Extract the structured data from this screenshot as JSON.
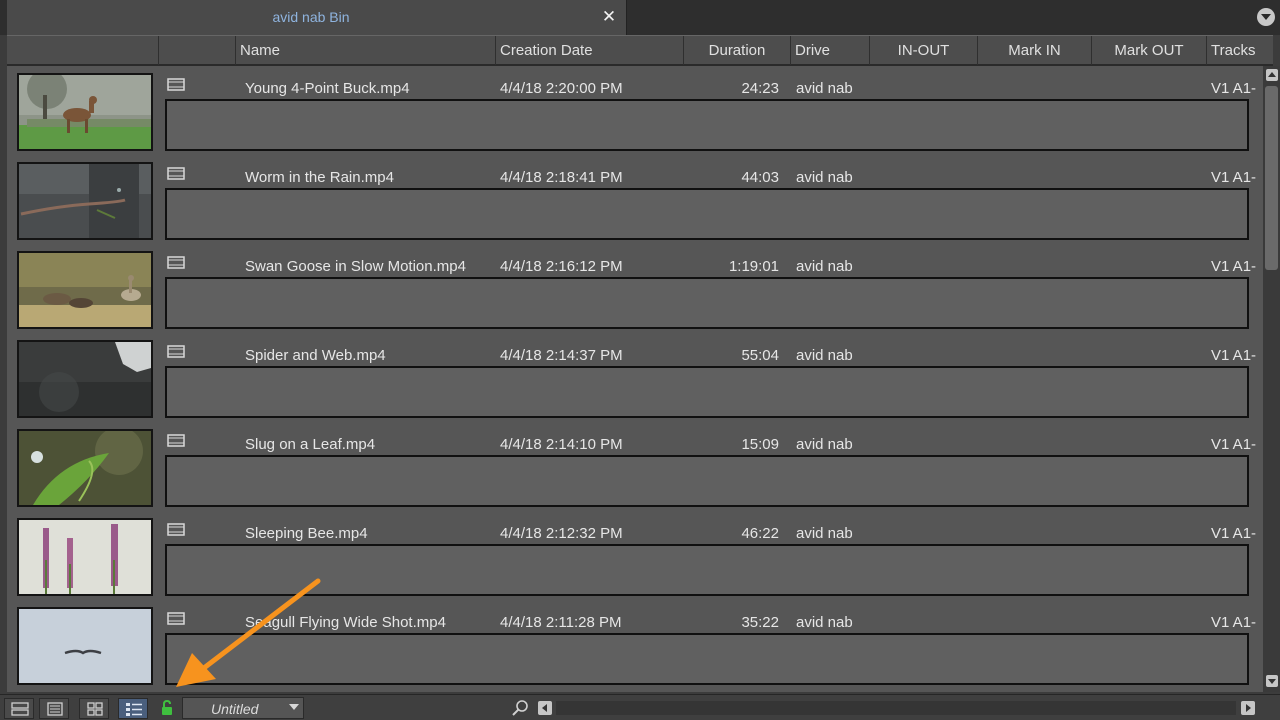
{
  "window": {
    "tab_title": "avid nab Bin",
    "close_glyph": "✕"
  },
  "columns": {
    "name": "Name",
    "creation_date": "Creation Date",
    "duration": "Duration",
    "drive": "Drive",
    "in_out": "IN-OUT",
    "mark_in": "Mark IN",
    "mark_out": "Mark OUT",
    "tracks": "Tracks"
  },
  "clips": [
    {
      "name": "Young 4-Point Buck.mp4",
      "creation_date": "4/4/18 2:20:00 PM",
      "duration": "24:23",
      "drive": "avid nab",
      "tracks": "V1 A1-",
      "thumb": "deer"
    },
    {
      "name": "Worm in the Rain.mp4",
      "creation_date": "4/4/18 2:18:41 PM",
      "duration": "44:03",
      "drive": "avid nab",
      "tracks": "V1 A1-",
      "thumb": "worm"
    },
    {
      "name": "Swan Goose in Slow Motion.mp4",
      "creation_date": "4/4/18 2:16:12 PM",
      "duration": "1:19:01",
      "drive": "avid nab",
      "tracks": "V1 A1-",
      "thumb": "geese"
    },
    {
      "name": "Spider and Web.mp4",
      "creation_date": "4/4/18 2:14:37 PM",
      "duration": "55:04",
      "drive": "avid nab",
      "tracks": "V1 A1-",
      "thumb": "spider"
    },
    {
      "name": "Slug on a Leaf.mp4",
      "creation_date": "4/4/18 2:14:10 PM",
      "duration": "15:09",
      "drive": "avid nab",
      "tracks": "V1 A1-",
      "thumb": "leaf"
    },
    {
      "name": "Sleeping Bee.mp4",
      "creation_date": "4/4/18 2:12:32 PM",
      "duration": "46:22",
      "drive": "avid nab",
      "tracks": "V1 A1-",
      "thumb": "flowers"
    },
    {
      "name": "Seagull Flying Wide Shot.mp4",
      "creation_date": "4/4/18 2:11:28 PM",
      "duration": "35:22",
      "drive": "avid nab",
      "tracks": "V1 A1-",
      "thumb": "seagull"
    }
  ],
  "bottom_bar": {
    "bin_view_name": "Untitled",
    "view_modes": [
      "brief-view",
      "text-view",
      "frame-view",
      "script-view"
    ],
    "active_view": "script-view",
    "lock_state": "unlocked"
  },
  "colors": {
    "tab_title": "#8fb4df",
    "lock_green": "#3fbf3f",
    "annotation_arrow": "#f7931e",
    "active_view_button": "#4a5f7d"
  },
  "icons": {
    "clip": "film-clip-icon",
    "lock": "lock-icon",
    "search": "search-icon",
    "menu": "chevron-down-icon"
  }
}
